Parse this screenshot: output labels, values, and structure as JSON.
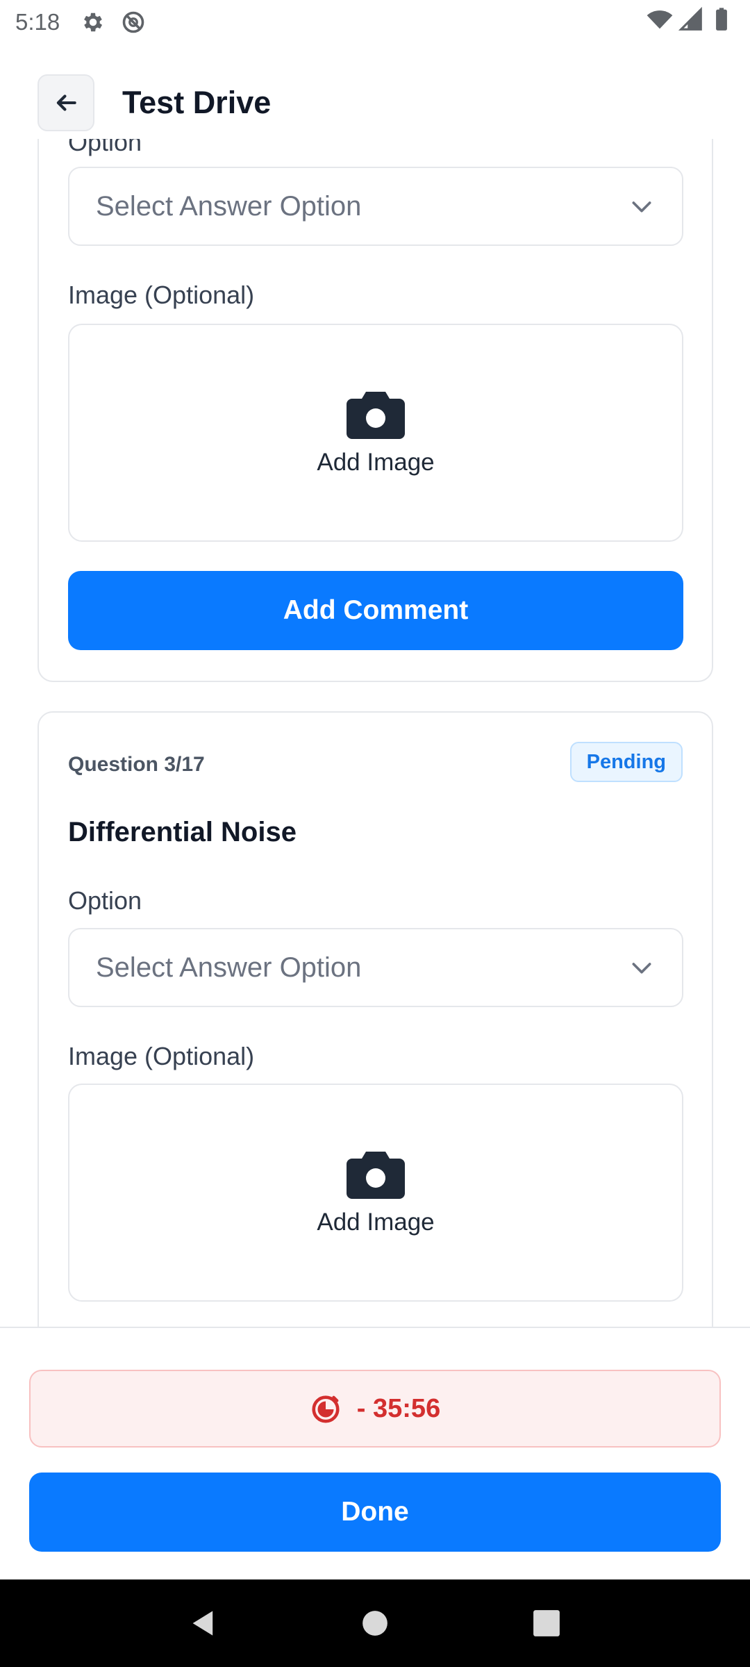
{
  "status_bar": {
    "time": "5:18"
  },
  "header": {
    "title": "Test Drive"
  },
  "card_previous": {
    "option_label": "Option",
    "select_placeholder": "Select Answer Option",
    "image_label": "Image (Optional)",
    "add_image_label": "Add Image",
    "add_comment_label": "Add Comment"
  },
  "card_question": {
    "number": "Question 3/17",
    "status": "Pending",
    "title": "Differential Noise",
    "option_label": "Option",
    "select_placeholder": "Select Answer Option",
    "image_label": "Image (Optional)",
    "add_image_label": "Add Image"
  },
  "timer": {
    "text": "- 35:56"
  },
  "actions": {
    "done_label": "Done"
  },
  "colors": {
    "primary": "#0a7aff",
    "timer_text": "#d32f2f",
    "timer_bg": "#fdf0f0",
    "badge_text": "#1677e8",
    "badge_bg": "#eaf5ff"
  },
  "icons": {
    "status_left": [
      "gear-icon",
      "no-sync-icon"
    ],
    "status_right": [
      "wifi-icon",
      "signal-icon",
      "battery-icon"
    ],
    "header": "arrow-left-icon",
    "select": "chevron-down-icon",
    "image": "camera-icon",
    "timer": "timer-icon",
    "nav": [
      "nav-back-icon",
      "nav-home-icon",
      "nav-recents-icon"
    ]
  }
}
